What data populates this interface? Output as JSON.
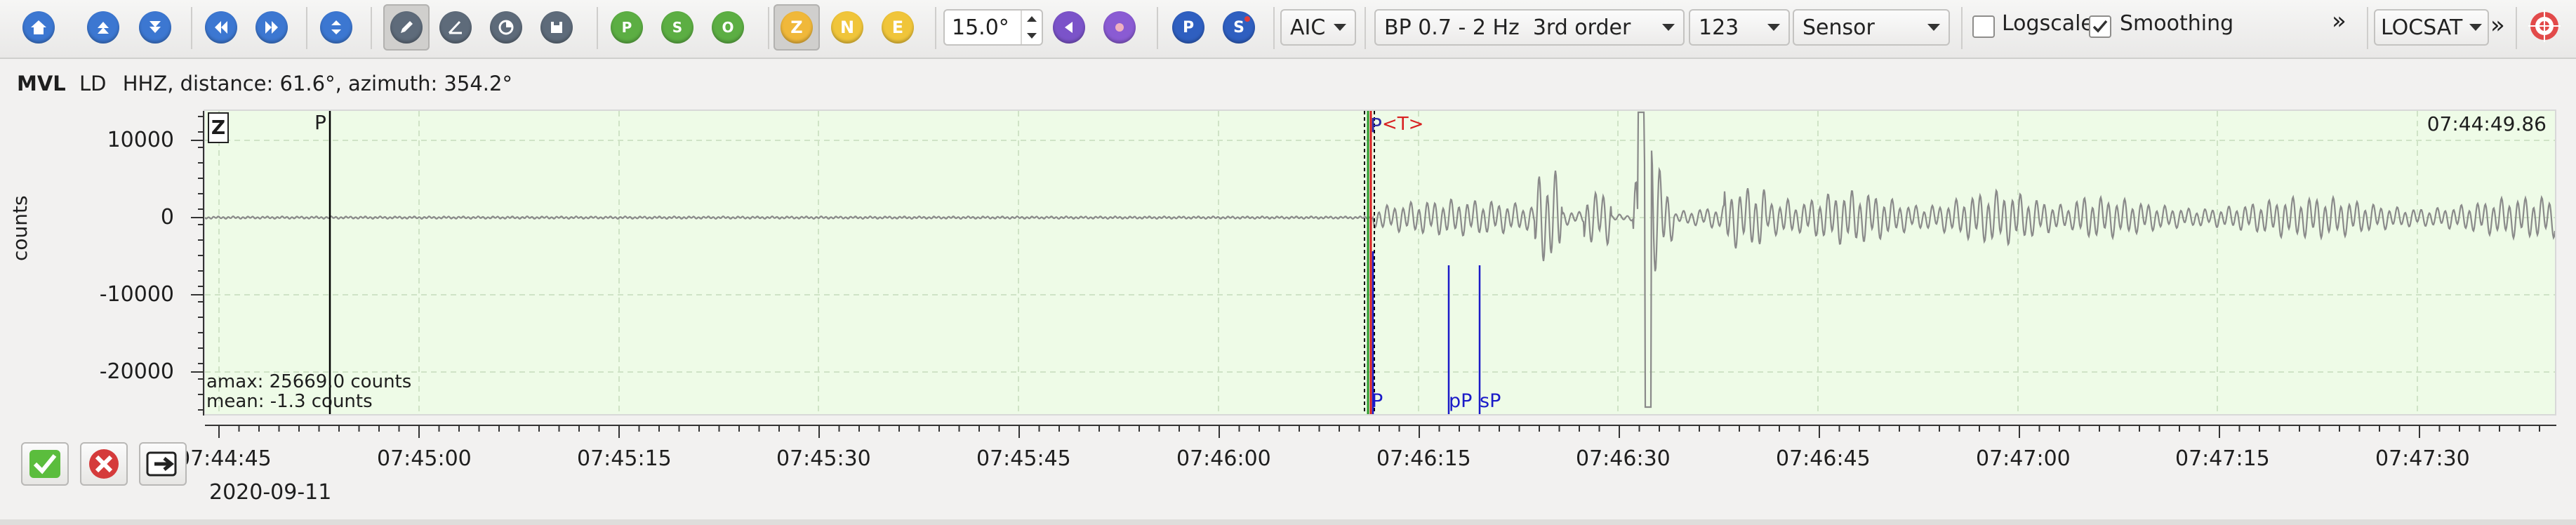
{
  "toolbar": {
    "buttons": [
      {
        "name": "home-icon",
        "color": "#3c77d1",
        "glyph": "⌂"
      },
      {
        "name": "up-icon",
        "color": "#3c77d1",
        "glyph": "▲"
      },
      {
        "name": "down-icon",
        "color": "#3c77d1",
        "glyph": "▼"
      },
      {
        "name": "previous-icon",
        "color": "#3c77d1",
        "glyph": "◀"
      },
      {
        "name": "next-icon",
        "color": "#3c77d1",
        "glyph": "▶"
      },
      {
        "name": "expand-icon",
        "color": "#3c77d1",
        "glyph": "⇕"
      },
      {
        "name": "pick-tool-icon",
        "color": "#5e6b7a",
        "glyph": "✎",
        "pressed": true
      },
      {
        "name": "angle-tool-icon",
        "color": "#5e6b7a",
        "glyph": "∠"
      },
      {
        "name": "measure-tool-icon",
        "color": "#5e6b7a",
        "glyph": "◔"
      },
      {
        "name": "save-icon",
        "color": "#5e6b7a",
        "glyph": "▣"
      },
      {
        "name": "align-p-icon",
        "color": "#5cae43",
        "glyph": "P"
      },
      {
        "name": "align-s-icon",
        "color": "#5cae43",
        "glyph": "S"
      },
      {
        "name": "align-origin-icon",
        "color": "#5cae43",
        "glyph": "O"
      }
    ],
    "components": [
      {
        "label": "Z",
        "color": "#f0b83a",
        "pressed": true
      },
      {
        "label": "N",
        "color": "#f0c53a"
      },
      {
        "label": "E",
        "color": "#f0c53a"
      }
    ],
    "rotation": "15.0°",
    "extra_buttons": [
      {
        "name": "filter-purple-icon",
        "color": "#7b53c9",
        "glyph": "◀"
      },
      {
        "name": "filter-violet-icon",
        "color": "#8a5bd3",
        "glyph": "●"
      },
      {
        "name": "pick-p-button",
        "color": "#2f5fc0",
        "glyph": "P"
      },
      {
        "name": "pick-s-button",
        "color": "#2f5fc0",
        "glyph": "S"
      }
    ],
    "picker_method": "AIC",
    "filter": "BP 0.7 - 2 Hz  3rd order",
    "rotation_mode": "123",
    "unit": "Sensor",
    "logscale_label": "Logscale",
    "logscale_checked": false,
    "smoothing_label": "Smoothing",
    "smoothing_checked": true,
    "overflow_glyph": "»",
    "locator": "LOCSAT",
    "overflow2_glyph": "»"
  },
  "station_header": {
    "station": "MVL",
    "network": "LD",
    "channel": "HHZ",
    "info": "distance: 61.6°, azimuth: 354.2°"
  },
  "plot": {
    "component_label": "Z",
    "ylabel": "counts",
    "yticks": [
      "10000",
      "0",
      "-10000",
      "-20000"
    ],
    "ytick_values": [
      10000,
      0,
      -10000,
      -20000
    ],
    "time_label": "07:44:49.86",
    "amax": "amax: 25669.0 counts",
    "mean": "mean: -1.3 counts",
    "xticks": [
      "07:44:45",
      "07:45:00",
      "07:45:15",
      "07:45:30",
      "07:45:45",
      "07:46:00",
      "07:46:15",
      "07:46:30",
      "07:46:45",
      "07:47:00",
      "07:47:15",
      "07:47:30"
    ],
    "date": "2020-09-11",
    "picks": [
      {
        "label": "P",
        "color": "#000000"
      },
      {
        "label": "P",
        "color": "#2c2ca6"
      },
      {
        "label": "<T>",
        "color": "#d82020"
      }
    ],
    "theoretical": [
      {
        "label": "P",
        "color": "#1a1ac8"
      },
      {
        "label": "pP",
        "color": "#1a1ac8"
      },
      {
        "label": "sP",
        "color": "#1a1ac8"
      }
    ]
  },
  "actions": [
    {
      "name": "accept-button",
      "glyph": "✔",
      "color": "#3f9a2f"
    },
    {
      "name": "reject-button",
      "glyph": "✖",
      "color": "#d53b3b"
    },
    {
      "name": "export-button",
      "glyph": "➦",
      "color": "#222222"
    }
  ]
}
